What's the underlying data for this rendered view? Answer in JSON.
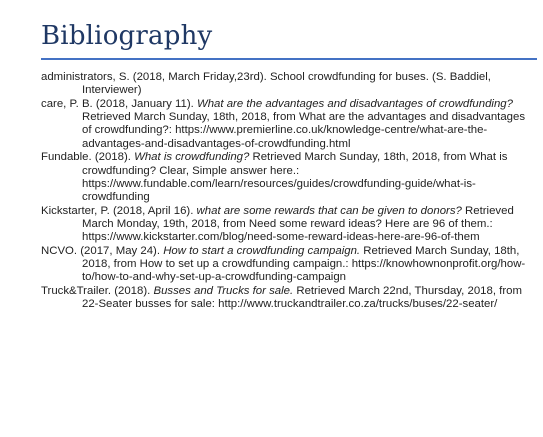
{
  "document": {
    "heading": "Bibliography",
    "colors": {
      "heading_text": "#1F3864",
      "heading_rule": "#4472C4",
      "body_text": "#222222"
    },
    "references": [
      {
        "before": "administrators, S. (2018, March Friday,23rd). School crowdfunding for buses. (S. Baddiel, Interviewer)",
        "title": "",
        "after": ""
      },
      {
        "before": "care, P. B. (2018, January 11). ",
        "title": "What are the advantages and disadvantages of crowdfunding?",
        "after": " Retrieved March Sunday, 18th, 2018, from What are the advantages and disadvantages of crowdfunding?: https://www.premierline.co.uk/knowledge-centre/what-are-the-advantages-and-disadvantages-of-crowdfunding.html"
      },
      {
        "before": "Fundable. (2018). ",
        "title": "What is crowdfunding?",
        "after": " Retrieved March Sunday, 18th, 2018, from What is crowdfunding? Clear, Simple answer here.: https://www.fundable.com/learn/resources/guides/crowdfunding-guide/what-is-crowdfunding"
      },
      {
        "before": "Kickstarter, P. (2018, April 16). ",
        "title": "what are some rewards that can be given to donors?",
        "after": " Retrieved March Monday, 19th, 2018, from Need some reward ideas? Here are 96 of them.: https://www.kickstarter.com/blog/need-some-reward-ideas-here-are-96-of-them"
      },
      {
        "before": "NCVO. (2017, May 24). ",
        "title": "How to start a crowdfunding campaign.",
        "after": " Retrieved March Sunday, 18th, 2018, from How to set up a crowdfunding campaign.: https://knowhownonprofit.org/how-to/how-to-and-why-set-up-a-crowdfunding-campaign"
      },
      {
        "before": "Truck&Trailer. (2018). ",
        "title": "Busses and Trucks for sale.",
        "after": " Retrieved March 22nd, Thursday, 2018, from 22-Seater busses for sale: http://www.truckandtrailer.co.za/trucks/buses/22-seater/"
      }
    ]
  }
}
